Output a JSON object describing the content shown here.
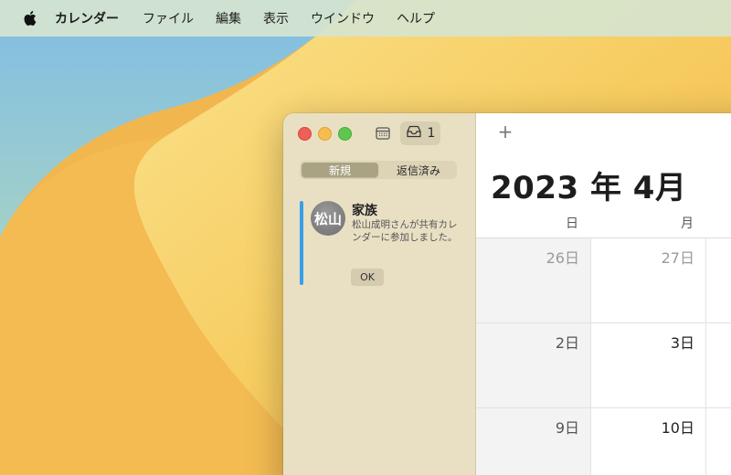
{
  "menubar": {
    "app_name": "カレンダー",
    "items": [
      "ファイル",
      "編集",
      "表示",
      "ウインドウ",
      "ヘルプ"
    ]
  },
  "sidebar": {
    "inbox_count": "1",
    "tabs": [
      {
        "label": "新規",
        "active": true
      },
      {
        "label": "返信済み",
        "active": false
      }
    ],
    "invitation": {
      "avatar_text": "松山",
      "calendar_name": "家族",
      "message": "松山成明さんが共有カレンダーに参加しました。",
      "ok_label": "OK",
      "accent_color": "#3b9ee8"
    }
  },
  "calendar": {
    "add_label": "+",
    "title": "2023 年 4月",
    "weekdays": [
      "日",
      "月"
    ],
    "rows": [
      [
        {
          "day": "26日",
          "muted": true
        },
        {
          "day": "27日",
          "muted": true
        }
      ],
      [
        {
          "day": "2日",
          "muted": false
        },
        {
          "day": "3日",
          "muted": false
        }
      ],
      [
        {
          "day": "9日",
          "muted": false
        },
        {
          "day": "10日",
          "muted": false
        }
      ]
    ]
  }
}
